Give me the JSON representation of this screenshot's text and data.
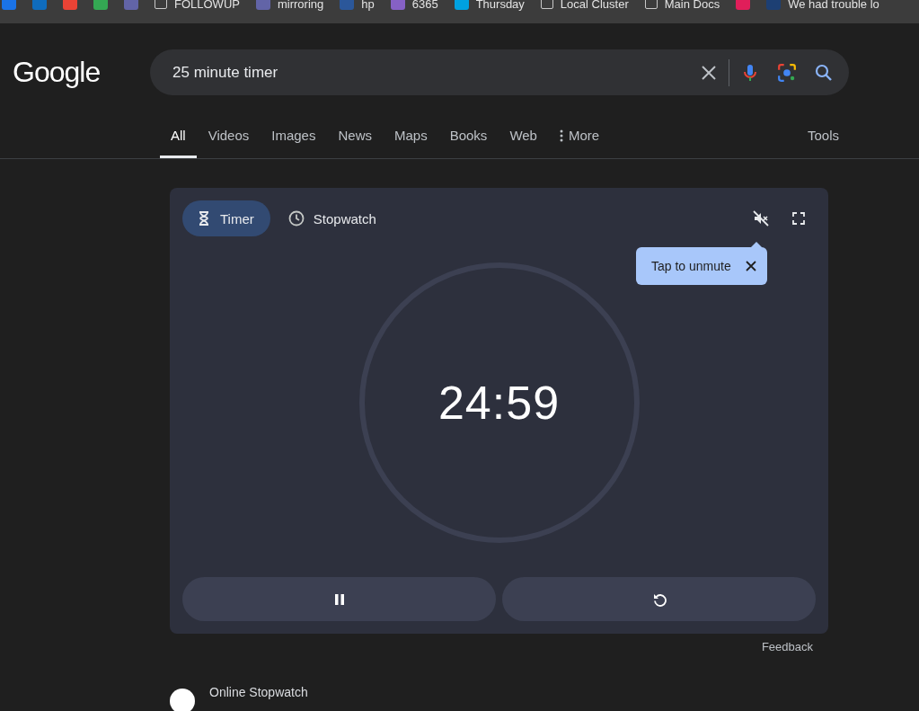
{
  "bookmarks": [
    {
      "kind": "site",
      "color": "#1a73e8"
    },
    {
      "kind": "site",
      "color": "#0f6cbd"
    },
    {
      "kind": "site",
      "color": "#ea4335"
    },
    {
      "kind": "site",
      "color": "#34a853"
    },
    {
      "kind": "site",
      "color": "#6264a7"
    },
    {
      "kind": "folder",
      "label": "FOLLOWUP"
    },
    {
      "kind": "site",
      "color": "#6264a7",
      "label": "mirroring"
    },
    {
      "kind": "site",
      "color": "#2b579a",
      "label": "hp"
    },
    {
      "kind": "site",
      "color": "#8661c5",
      "label": "6365"
    },
    {
      "kind": "site",
      "color": "#00a1e0",
      "label": "Thursday"
    },
    {
      "kind": "folder",
      "label": "Local Cluster"
    },
    {
      "kind": "folder",
      "label": "Main Docs"
    },
    {
      "kind": "site",
      "color": "#e01e5a"
    },
    {
      "kind": "site",
      "color": "#1d3f73",
      "label": "We had trouble lo"
    }
  ],
  "logo": "Google",
  "search": {
    "value": "25 minute timer"
  },
  "nav_tabs": [
    {
      "label": "All",
      "selected": true
    },
    {
      "label": "Videos",
      "selected": false
    },
    {
      "label": "Images",
      "selected": false
    },
    {
      "label": "News",
      "selected": false
    },
    {
      "label": "Maps",
      "selected": false
    },
    {
      "label": "Books",
      "selected": false
    },
    {
      "label": "Web",
      "selected": false
    },
    {
      "label": "More",
      "selected": false,
      "kind": "menu"
    }
  ],
  "tools": "Tools",
  "timer": {
    "modes": [
      {
        "label": "Timer",
        "selected": true,
        "kind": "timer"
      },
      {
        "label": "Stopwatch",
        "selected": false,
        "kind": "stopwatch"
      }
    ],
    "muted": true,
    "tooltip": "Tap to unmute",
    "time": "24:59",
    "running": true
  },
  "feedback": "Feedback",
  "result": {
    "title": "Online Stopwatch"
  }
}
